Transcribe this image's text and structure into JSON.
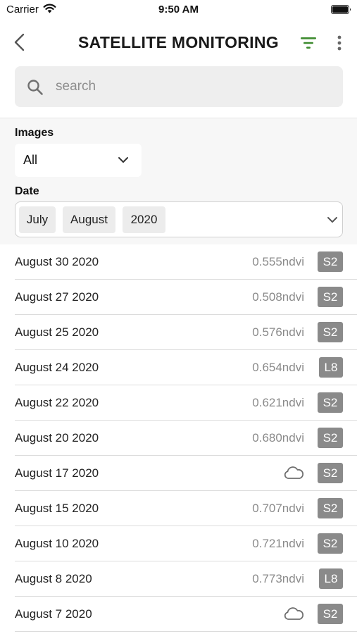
{
  "status": {
    "carrier": "Carrier",
    "time": "9:50 AM"
  },
  "header": {
    "title": "SATELLITE MONITORING",
    "accent_color": "#3d8b2f"
  },
  "search": {
    "placeholder": "search",
    "value": ""
  },
  "filters": {
    "images_label": "Images",
    "images_value": "All",
    "date_label": "Date",
    "date_chips": [
      "July",
      "August",
      "2020"
    ]
  },
  "items": [
    {
      "date": "August 30 2020",
      "ndvi": "0.555ndvi",
      "satellite": "S2",
      "cloudy": false
    },
    {
      "date": "August 27 2020",
      "ndvi": "0.508ndvi",
      "satellite": "S2",
      "cloudy": false
    },
    {
      "date": "August 25 2020",
      "ndvi": "0.576ndvi",
      "satellite": "S2",
      "cloudy": false
    },
    {
      "date": "August 24 2020",
      "ndvi": "0.654ndvi",
      "satellite": "L8",
      "cloudy": false
    },
    {
      "date": "August 22 2020",
      "ndvi": "0.621ndvi",
      "satellite": "S2",
      "cloudy": false
    },
    {
      "date": "August 20 2020",
      "ndvi": "0.680ndvi",
      "satellite": "S2",
      "cloudy": false
    },
    {
      "date": "August 17 2020",
      "ndvi": "",
      "satellite": "S2",
      "cloudy": true
    },
    {
      "date": "August 15 2020",
      "ndvi": "0.707ndvi",
      "satellite": "S2",
      "cloudy": false
    },
    {
      "date": "August 10 2020",
      "ndvi": "0.721ndvi",
      "satellite": "S2",
      "cloudy": false
    },
    {
      "date": "August 8 2020",
      "ndvi": "0.773ndvi",
      "satellite": "L8",
      "cloudy": false
    },
    {
      "date": "August 7 2020",
      "ndvi": "",
      "satellite": "S2",
      "cloudy": true
    }
  ]
}
